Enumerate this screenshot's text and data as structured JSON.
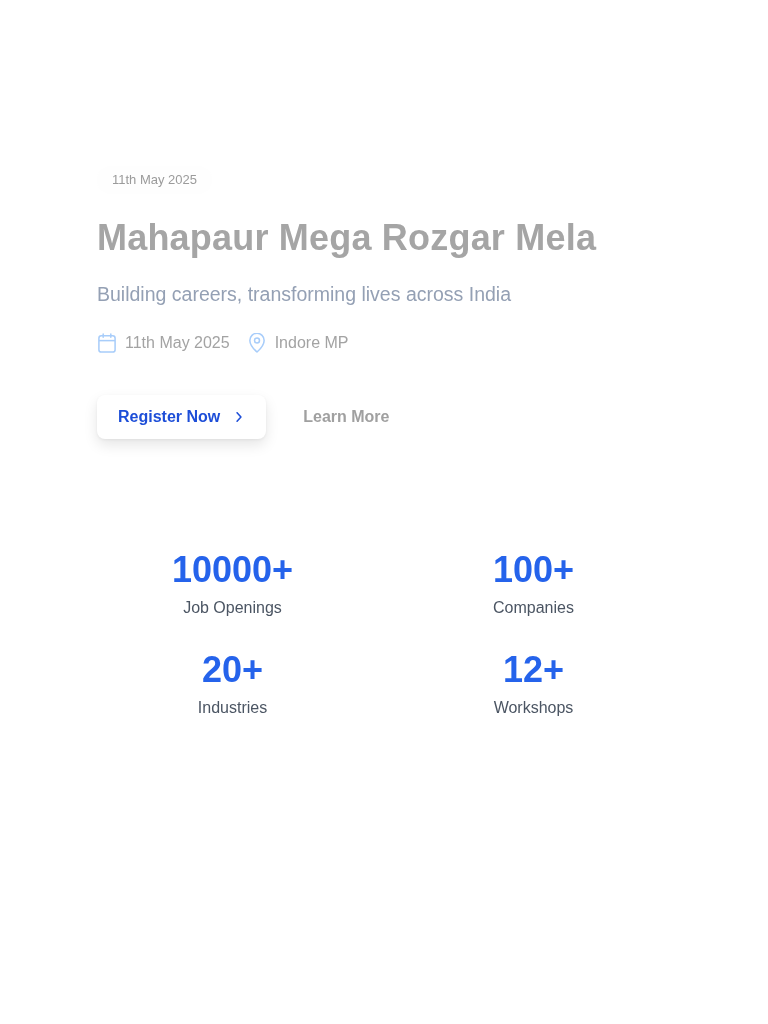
{
  "hero": {
    "date_badge": "11th May 2025",
    "title": "Mahapaur Mega Rozgar Mela",
    "subtitle": "Building careers, transforming lives across India",
    "meta": [
      {
        "kind": "date",
        "text": "11th May 2025"
      },
      {
        "kind": "location",
        "text": "Indore MP"
      }
    ],
    "buttons": [
      {
        "kind": "primary",
        "label": "Register Now"
      },
      {
        "kind": "link",
        "label": "Learn More"
      }
    ]
  },
  "stats": [
    {
      "value": "10000+",
      "label": "Job Openings"
    },
    {
      "value": "100+",
      "label": "Companies"
    },
    {
      "value": "20+",
      "label": "Industries"
    },
    {
      "value": "12+",
      "label": "Workshops"
    }
  ]
}
